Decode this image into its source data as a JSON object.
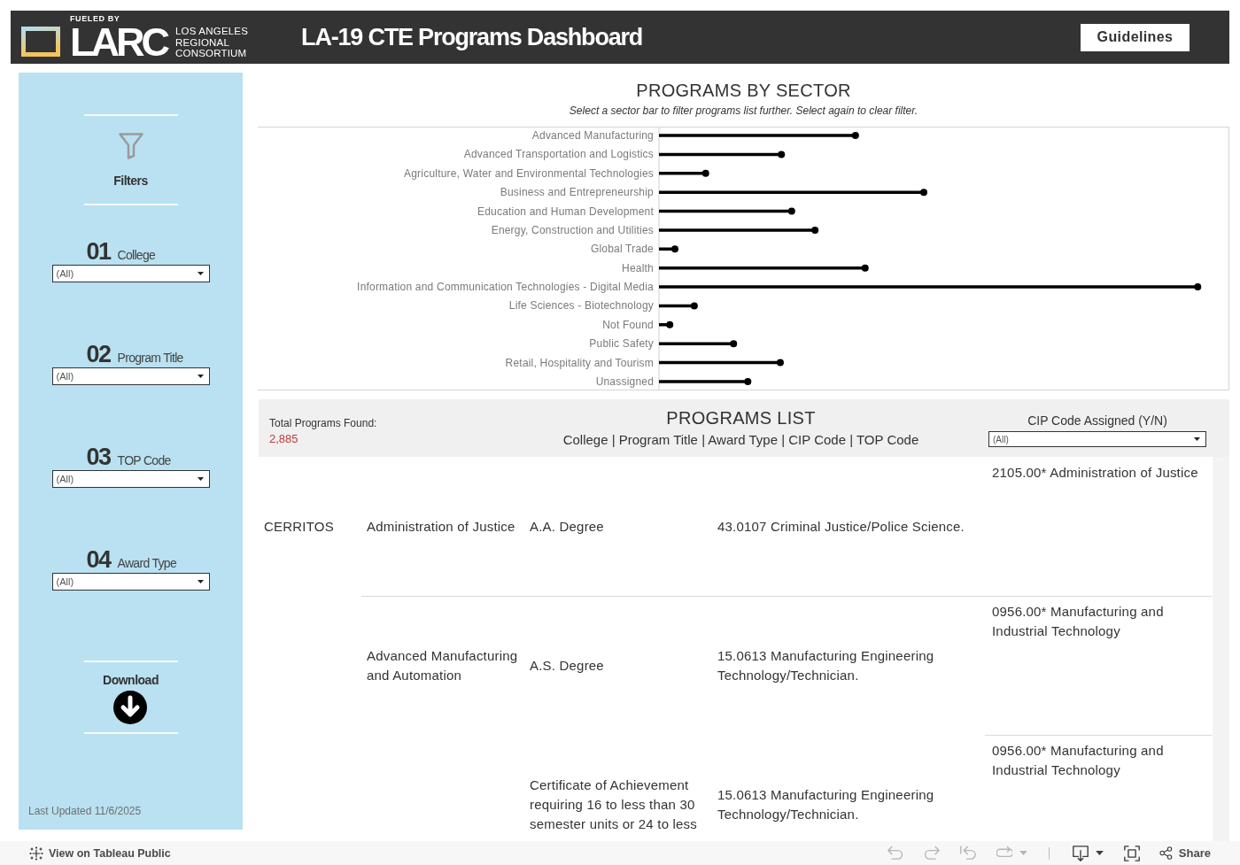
{
  "header": {
    "logo": {
      "tagline": "FUELED BY",
      "wordmark": "LARC",
      "org_lines": [
        "LOS ANGELES",
        "REGIONAL",
        "CONSORTIUM"
      ]
    },
    "title": "LA-19 CTE Programs Dashboard",
    "guidelines_button": "Guidelines"
  },
  "sidebar": {
    "heading": "Filters",
    "filters": [
      {
        "number": "01",
        "label": "College",
        "value": "(All)"
      },
      {
        "number": "02",
        "label": "Program Title",
        "value": "(All)"
      },
      {
        "number": "03",
        "label": "TOP Code",
        "value": "(All)"
      },
      {
        "number": "04",
        "label": "Award Type",
        "value": "(All)"
      }
    ],
    "download_label": "Download",
    "last_updated": "Last Updated 11/6/2025"
  },
  "sector_chart": {
    "title": "PROGRAMS BY SECTOR",
    "subtitle": "Select a sector bar to filter programs list further. Select again to clear filter.",
    "sectors": [
      "Advanced Manufacturing",
      "Advanced Transportation and Logistics",
      "Agriculture, Water and Environmental Technologies",
      "Business and Entrepreneurship",
      "Education and Human Development",
      "Energy, Construction and Utilities",
      "Global Trade",
      "Health",
      "Information and Communication Technologies - Digital Media",
      "Life Sciences - Biotechnology",
      "Not Found",
      "Public Safety",
      "Retail, Hospitality and Tourism",
      "Unassigned"
    ]
  },
  "programs_list": {
    "total_label": "Total Programs Found:",
    "total_value": "2,885",
    "title": "PROGRAMS LIST",
    "columns_caption": "College | Program Title | Award Type | CIP Code | TOP Code",
    "cip_filter": {
      "label": "CIP Code Assigned (Y/N)",
      "value": "(All)"
    },
    "rows": [
      {
        "college": "CERRITOS",
        "program_title": "Administration of Justice",
        "award_type": "A.A. Degree",
        "cip_code": "43.0107 Criminal Justice/Police Science.",
        "top_code": "2105.00* Administration of Justice"
      },
      {
        "program_title": "Advanced Manufacturing and Automation",
        "award_type": "A.S. Degree",
        "cip_code": "15.0613 Manufacturing Engineering Technology/Technician.",
        "top_code": "0956.00* Manufacturing and Industrial Technology"
      },
      {
        "award_type": "Certificate of Achievement requiring 16 to less than 30 semester units or 24 to less",
        "cip_code": "15.0613 Manufacturing Engineering Technology/Technician.",
        "top_code": "0956.00* Manufacturing and Industrial Technology"
      }
    ]
  },
  "bottom_bar": {
    "link": "View on Tableau Public",
    "history_tools": [
      {
        "kind": "undo",
        "disabled": true,
        "dropdown": false
      },
      {
        "kind": "redo",
        "disabled": true,
        "dropdown": false
      },
      {
        "kind": "revert",
        "disabled": true,
        "dropdown": false
      },
      {
        "kind": "refresh",
        "disabled": true,
        "dropdown": true
      }
    ],
    "view_tools": [
      {
        "kind": "download",
        "disabled": false,
        "dropdown": true
      },
      {
        "kind": "fullscreen",
        "disabled": false,
        "dropdown": false
      }
    ],
    "share": "Share"
  }
}
